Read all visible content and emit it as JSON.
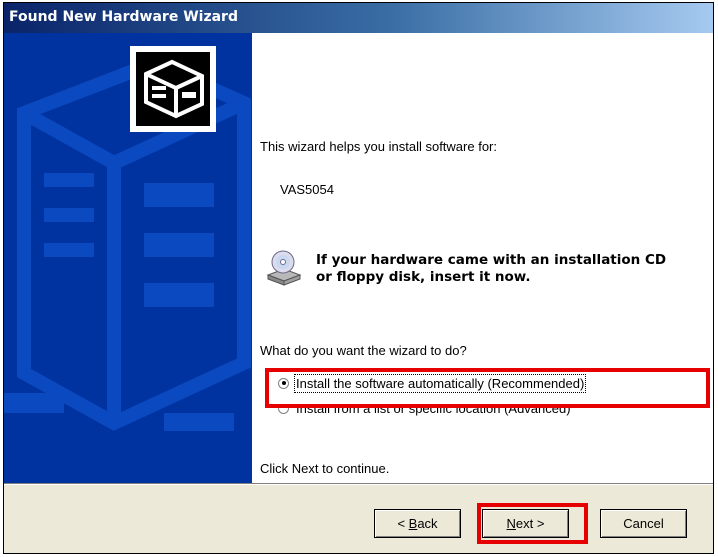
{
  "window": {
    "title": "Found New Hardware Wizard"
  },
  "content": {
    "intro": "This wizard helps you install software for:",
    "device_name": "VAS5054",
    "cd_message_line1": "If your hardware came with an installation CD",
    "cd_message_line2": "or floppy disk, insert it now.",
    "question": "What do you want the wizard to do?",
    "options": [
      {
        "label": "Install the software automatically (Recommended)",
        "selected": true
      },
      {
        "label": "Install from a list or specific location (Advanced)",
        "selected": false
      }
    ],
    "continue_hint": "Click Next to continue."
  },
  "buttons": {
    "back_access": "B",
    "back_rest": "ack",
    "next_access": "N",
    "next_rest": "ext >",
    "cancel": "Cancel"
  },
  "icons": {
    "hardware": "hardware-wizard-icon",
    "cd": "cd-drive-icon"
  },
  "colors": {
    "title_bar": "#0a246a",
    "side_panel": "#0033a0",
    "highlight": "#e60000",
    "button_face": "#ece9d8"
  }
}
